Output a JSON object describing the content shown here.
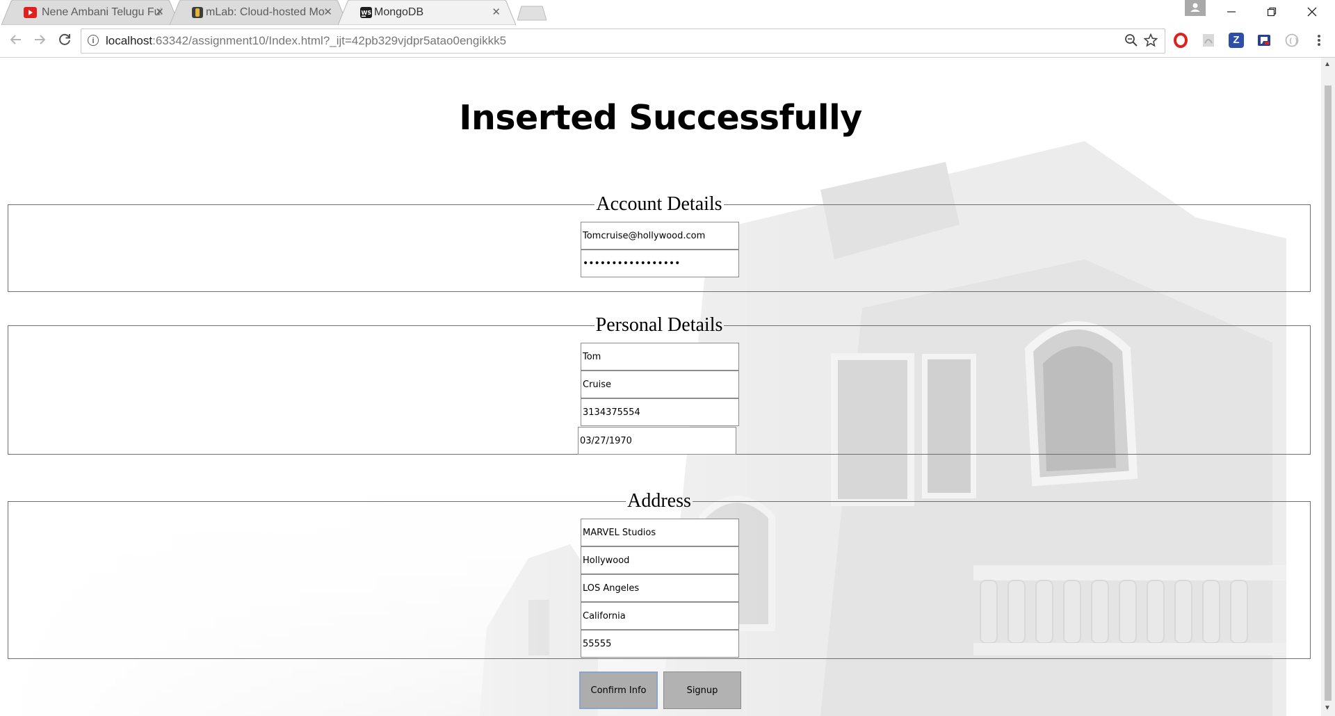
{
  "browser": {
    "tabs": [
      {
        "title": "Nene Ambani Telugu Full",
        "favicon": "youtube-icon",
        "active": false
      },
      {
        "title": "mLab: Cloud-hosted Mon",
        "favicon": "mlab-icon",
        "active": false
      },
      {
        "title": "MongoDB",
        "favicon": "webstorm-icon",
        "active": true
      }
    ],
    "tab_close_glyph": "✕",
    "address": {
      "host": "localhost",
      "rest": ":63342/assignment10/Index.html?_ijt=42pb329vjdpr5atao0engikkk5"
    },
    "extensions": [
      "opera-icon",
      "pdf-icon",
      "zotero-icon",
      "flag-extension-icon",
      "circle-extension-icon"
    ],
    "extension_labels": {
      "zotero": "Z"
    },
    "colors": {
      "accent_red": "#e0201f",
      "zotero_blue": "#2d4fa8"
    }
  },
  "page": {
    "heading": "Inserted Successfully",
    "account": {
      "legend": "Account Details",
      "email": "Tomcruise@hollywood.com",
      "password_mask": "•••••••••••••••••"
    },
    "personal": {
      "legend": "Personal Details",
      "first_name": "Tom",
      "last_name": "Cruise",
      "phone": "3134375554",
      "dob": "03/27/1970"
    },
    "address": {
      "legend": "Address",
      "line1": "MARVEL Studios",
      "line2": "Hollywood",
      "city": "LOS Angeles",
      "state": "California",
      "zip": "55555"
    },
    "buttons": {
      "confirm": "Confirm Info",
      "signup": "Signup"
    }
  }
}
